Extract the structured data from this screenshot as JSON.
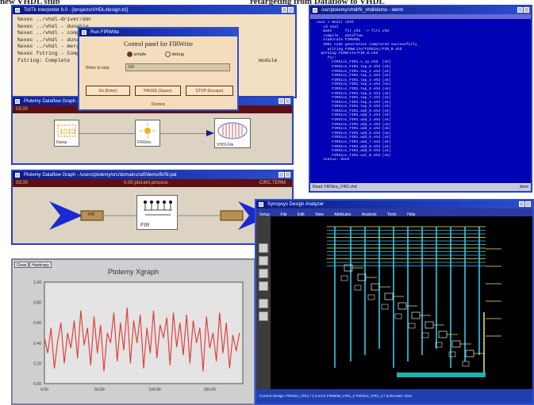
{
  "header": {
    "left_text": "new VHDL stub",
    "right_text": "retargeting from Dataflow to VHDL"
  },
  "tcl_window": {
    "title": "Tcl/Tk Interpreter 8.0 - [/projects/VHDL/design.tcl]",
    "lines": [
      "%exec ../vhdl-driver/ddr",
      "%exec ../vhdl - dunable",
      "%exec ../vhdl - complete",
      "%exec ../vhdl - dunable",
      "%exec ../vhdl - merged",
      "%exec fstring - Complete",
      "fstring: Complete"
    ],
    "trailing_word": "module"
  },
  "control_dialog": {
    "title": "Run FIRWrite",
    "heading": "Control panel for FIRWrite",
    "radio_1": "simple",
    "radio_2": "debug",
    "field_label": "When to stop:",
    "field_value": "200",
    "button_1": "Go (Enter)",
    "button_2": "PAUSE (Space)",
    "button_3": "STOP (Escape)",
    "footer": "Dismiss"
  },
  "dataflow_window_1": {
    "title": "Ptolemy Dataflow Graph - FIRWrite",
    "darkbar_text": "03.00",
    "block_1_label": "Ramp",
    "block_2_label": "FIRSinc",
    "block_3_label": "VHDLFile"
  },
  "dataflow_window_2": {
    "title": "Ptolemy Dataflow Graph - /users/ptolemy/src/domains/sdf/demo/fir/fir.pal",
    "darkbar_left": "03.00",
    "darkbar_center": "0.00 ptol.ent.process",
    "darkbar_right": "CIRC.TERM",
    "chip_label": "FIR",
    "fir_block_label": "FIR"
  },
  "xgraph": {
    "tab_1": "Close",
    "tab_2": "Hardcopy",
    "title": "Ptolemy Xgraph",
    "y_ticks": [
      "1.00",
      "0.80",
      "0.60",
      "0.40",
      "0.20",
      "0.00"
    ],
    "x_ticks": [
      "0.00",
      "50.00",
      "100.00",
      "150.00"
    ]
  },
  "xterm": {
    "title": "/usr/ptolemy/vhdl/fir_vhdl/demo - xterm",
    "lines": [
      "sun1 > mkdir vhdl",
      "   cd vhdl",
      "   make      fir_vhd  -> fir1.vhd",
      "   compile   dataflow",
      "   elaborate FIRVHDL",
      "",
      "   VHDL code generation completed successfully",
      "",
      "     writing FIRWrite/FIRSinc/FIR_0.vhd",
      "  working FIRWrite/FIR_0.vhd",
      "     fir:",
      "       FIRSinc_FIR1.v_cp.vhd  (ok)",
      "       FIRSinc_FIR1.tap_0.vhd (ok)",
      "       FIRSinc_FIR1.tap_1.vhd (ok)",
      "       FIRSinc_FIR1.tap_2.vhd (ok)",
      "       FIRSinc_FIR1.tap_3.vhd (ok)",
      "       FIRSinc_FIR1.tap_4.vhd (ok)",
      "       FIRSinc_FIR1.tap_5.vhd (ok)",
      "       FIRSinc_FIR1.tap_6.vhd (ok)",
      "       FIRSinc_FIR1.tap_7.vhd (ok)",
      "       FIRSinc_FIR1.tap_8.vhd (ok)",
      "       FIRSinc_FIR1.tap_9.vhd (ok)",
      "       FIRSinc_FIR1.add_0.vhd (ok)",
      "       FIRSinc_FIR1.add_1.vhd (ok)",
      "       FIRSinc_FIR1.add_2.vhd (ok)",
      "       FIRSinc_FIR1.add_3.vhd (ok)",
      "       FIRSinc_FIR1.add_4.vhd (ok)",
      "       FIRSinc_FIR1.add_5.vhd (ok)",
      "       FIRSinc_FIR1.add_6.vhd (ok)",
      "       FIRSinc_FIR1.add_7.vhd (ok)",
      "       FIRSinc_FIR1.add_8.vhd (ok)",
      "       FIRSinc_FIR1.add_9.vhd (ok)",
      "       FIRSinc_FIR1.out_0.vhd (ok)",
      "",
      "   status: done"
    ],
    "status_left": "Read: FIRSinc_FIR1.vhd",
    "status_right": "done"
  },
  "synopsys": {
    "title": "Synopsys Design Analyzer",
    "menu": [
      "Setup",
      "File",
      "Edit",
      "View",
      "Attributes",
      "Analysis",
      "Tools",
      "Help"
    ],
    "status_text": "Current Design: FIRSinc_FIR1  /  1.0 error  FIRWrite_FIR1_0 FIRSinc_FIR1_0  /  Schematic View"
  },
  "colors": {
    "tcl_bg": "#f2dfc2",
    "dialog_bg": "#f4ddbc",
    "dataflow_bg": "#dcd3c2",
    "dark_bar": "#5c0f14",
    "xterm_bg": "#0000b4",
    "synopsys_bg": "#000000",
    "wire_cyan": "#38c8e8",
    "plot_red": "#e04040"
  },
  "chart_data": {
    "type": "line",
    "title": "Ptolemy Xgraph",
    "xlabel": "",
    "ylabel": "",
    "xlim": [
      0,
      180
    ],
    "ylim": [
      0.0,
      1.0
    ],
    "x_ticks": [
      0,
      50,
      100,
      150
    ],
    "y_ticks": [
      0.0,
      0.2,
      0.4,
      0.6,
      0.8,
      1.0
    ],
    "grid": false,
    "series": [
      {
        "color": "#e04040",
        "x": [
          0,
          3,
          6,
          9,
          12,
          15,
          18,
          21,
          24,
          27,
          30,
          33,
          36,
          39,
          42,
          45,
          48,
          51,
          54,
          57,
          60,
          63,
          66,
          69,
          72,
          75,
          78,
          81,
          84,
          87,
          90,
          93,
          96,
          99,
          102,
          105,
          108,
          111,
          114,
          117,
          120,
          123,
          126,
          129,
          132,
          135,
          138,
          141,
          144,
          147,
          150,
          153,
          156,
          159,
          162,
          165,
          168,
          171,
          174,
          177
        ],
        "y": [
          0.45,
          0.3,
          0.55,
          0.15,
          0.42,
          0.6,
          0.2,
          0.5,
          0.35,
          0.62,
          0.25,
          0.72,
          0.38,
          0.55,
          0.18,
          0.66,
          0.3,
          0.58,
          0.12,
          0.5,
          0.4,
          0.7,
          0.22,
          0.6,
          0.33,
          0.75,
          0.2,
          0.62,
          0.4,
          0.68,
          0.15,
          0.55,
          0.3,
          0.72,
          0.25,
          0.58,
          0.45,
          0.65,
          0.18,
          0.7,
          0.36,
          0.6,
          0.28,
          0.68,
          0.2,
          0.62,
          0.4,
          0.55,
          0.12,
          0.66,
          0.35,
          0.5,
          0.22,
          0.7,
          0.3,
          0.6,
          0.15,
          0.48,
          0.32,
          0.5
        ]
      }
    ]
  }
}
